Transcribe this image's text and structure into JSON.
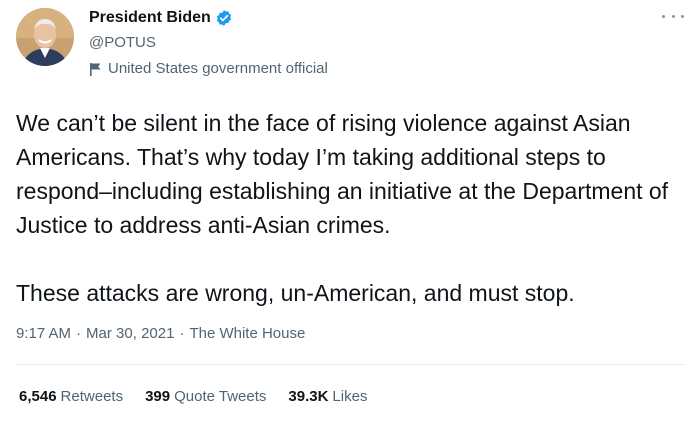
{
  "author": {
    "display_name": "President Biden",
    "handle": "@POTUS",
    "label": "United States government official",
    "avatar_icon": "profile-photo",
    "verified_icon": "verified-badge-icon",
    "verified_color": "#1d9bf0"
  },
  "tweet": {
    "paragraphs": [
      "We can’t be silent in the face of rising violence against Asian Americans. That’s why today I’m taking additional steps to respond–including establishing an initiative at the Department of Justice to address anti-Asian crimes.",
      "These attacks are wrong, un-American, and must stop."
    ]
  },
  "meta": {
    "time": "9:17 AM",
    "separator": "·",
    "date": "Mar 30, 2021",
    "source": "The White House"
  },
  "stats": {
    "retweets": {
      "count": "6,546",
      "label": "Retweets"
    },
    "quote_tweets": {
      "count": "399",
      "label": "Quote Tweets"
    },
    "likes": {
      "count": "39.3K",
      "label": "Likes"
    }
  },
  "colors": {
    "text_primary": "#0f1419",
    "text_secondary": "#536471",
    "divider": "#e6ecf0"
  }
}
